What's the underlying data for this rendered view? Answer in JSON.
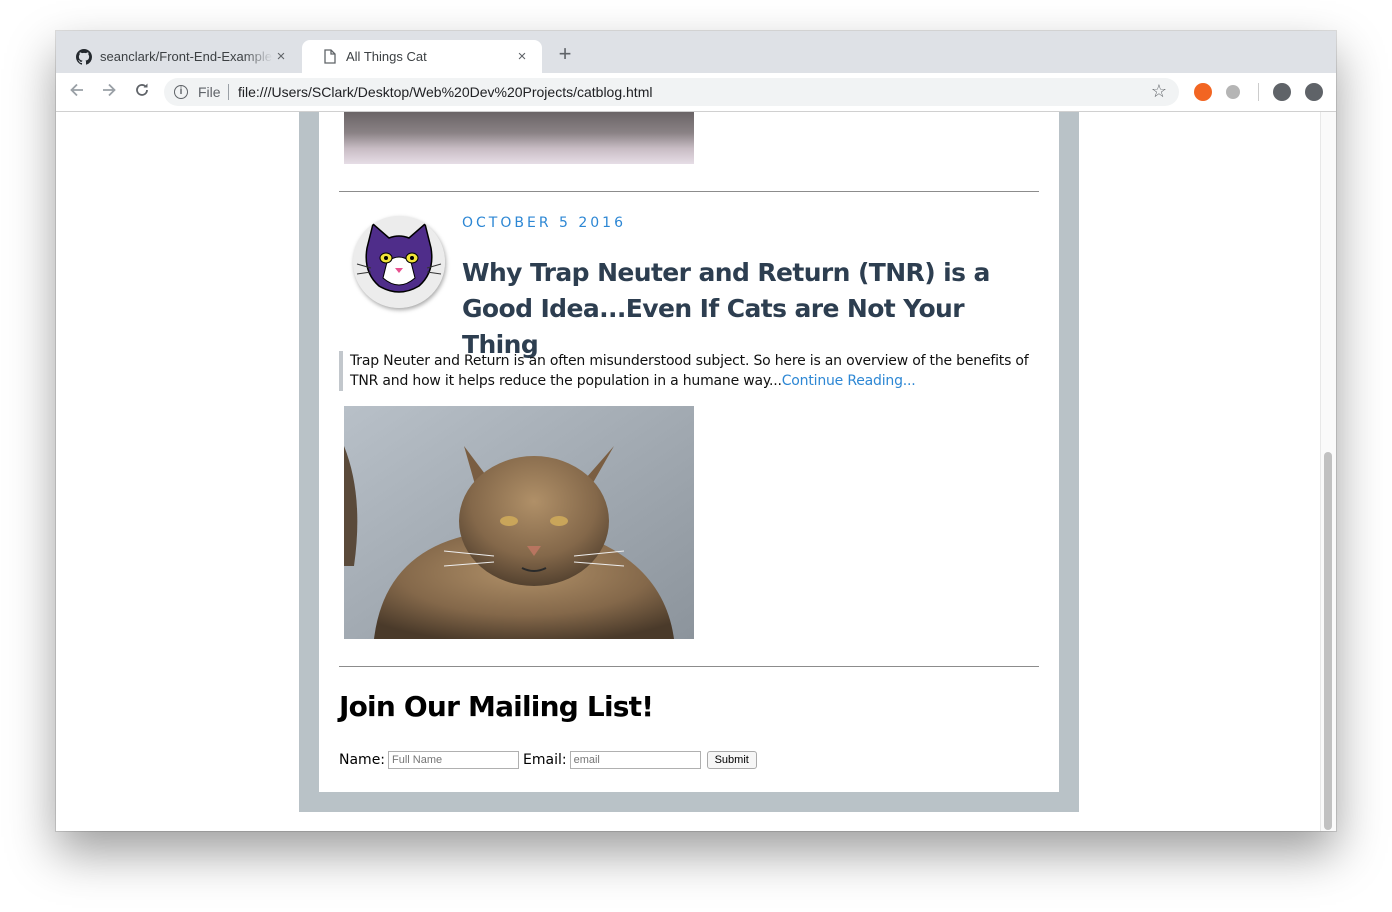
{
  "browser": {
    "tabs": [
      {
        "title": "seanclark/Front-End-Examples",
        "icon": "github-icon",
        "active": false
      },
      {
        "title": "All Things Cat",
        "icon": "page-icon",
        "active": true
      }
    ],
    "new_tab": "+",
    "close_glyph": "×",
    "address_scheme": "File",
    "url": "file:///Users/SClark/Desktop/Web%20Dev%20Projects/catblog.html"
  },
  "post": {
    "date": "OCTOBER 5 2016",
    "title": "Why Trap Neuter and Return (TNR) is a Good Idea...Even If Cats are Not Your Thing",
    "excerpt": "Trap Neuter and Return is an often misunderstood subject. So here is an overview of the benefits of TNR and how it helps reduce the population in a humane way...",
    "continue_link": "Continue Reading..."
  },
  "mailing": {
    "title": "Join Our Mailing List!",
    "name_label": "Name:",
    "name_placeholder": "Full Name",
    "email_label": "Email:",
    "email_placeholder": "email",
    "submit_label": "Submit"
  },
  "colors": {
    "accent": "#2d87d4",
    "title": "#2d3e50",
    "page_frame": "#b9c2c7",
    "tab_strip": "#dee1e6"
  }
}
